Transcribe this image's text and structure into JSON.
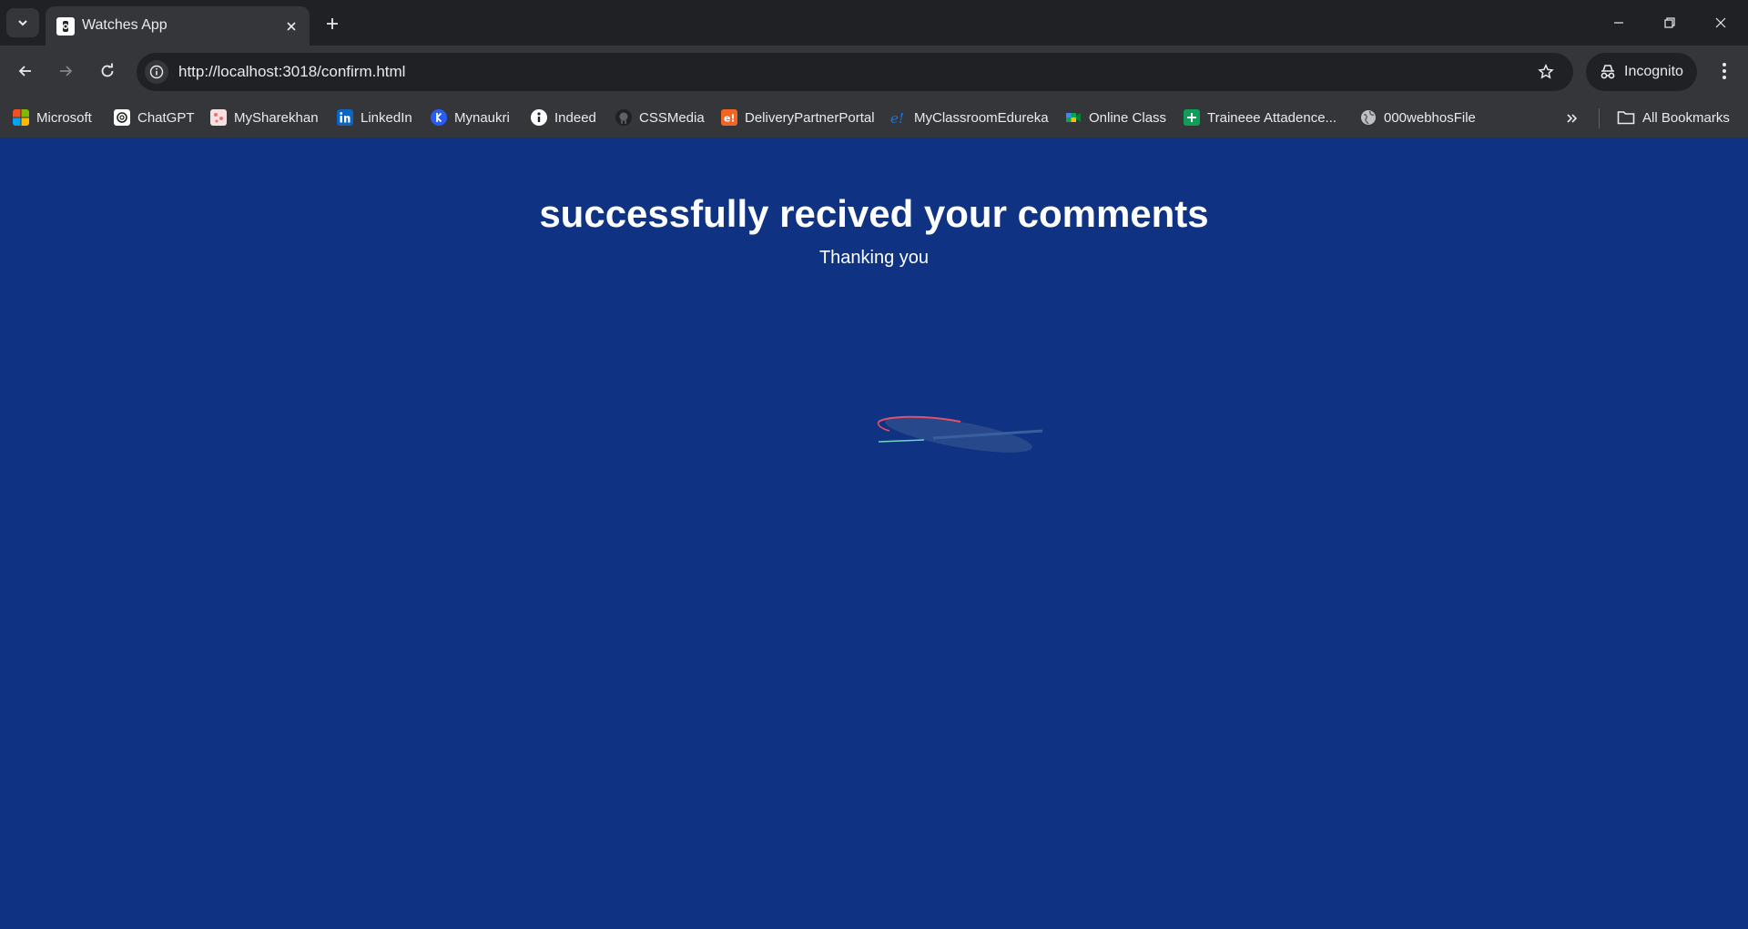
{
  "browser": {
    "tab": {
      "title": "Watches App"
    },
    "url": "http://localhost:3018/confirm.html",
    "incognito_label": "Incognito",
    "bookmarks": [
      {
        "label": "Microsoft",
        "icon": "microsoft-icon"
      },
      {
        "label": "ChatGPT",
        "icon": "chatgpt-icon"
      },
      {
        "label": "MySharekhan",
        "icon": "sharekhan-icon"
      },
      {
        "label": "LinkedIn",
        "icon": "linkedin-icon"
      },
      {
        "label": "Mynaukri",
        "icon": "naukri-icon"
      },
      {
        "label": "Indeed",
        "icon": "indeed-icon"
      },
      {
        "label": "CSSMedia",
        "icon": "github-icon"
      },
      {
        "label": "DeliveryPartnerPortal",
        "icon": "edureka-e-icon"
      },
      {
        "label": "MyClassroomEdureka",
        "icon": "edureka-icon"
      },
      {
        "label": "Online Class",
        "icon": "google-meet-icon"
      },
      {
        "label": "Traineee Attadence...",
        "icon": "sheets-icon"
      },
      {
        "label": "000webhosFile",
        "icon": "globe-icon"
      }
    ],
    "all_bookmarks_label": "All Bookmarks"
  },
  "page": {
    "heading": "successfully recived your comments",
    "subheading": "Thanking you",
    "background_color": "#0f3382"
  }
}
